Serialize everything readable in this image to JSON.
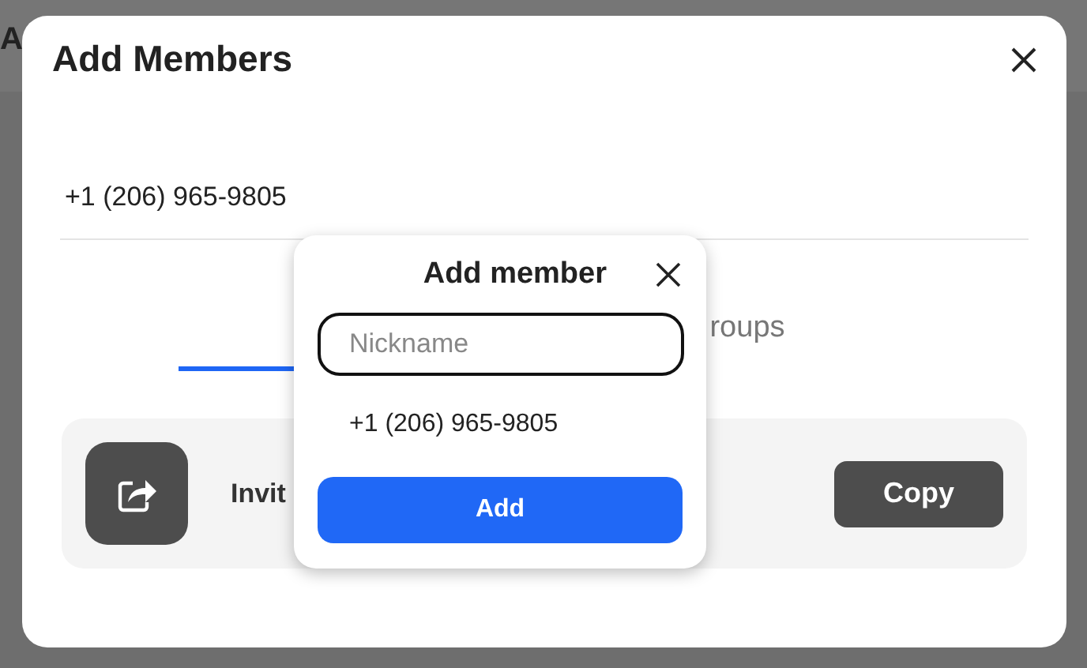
{
  "background_title": "A",
  "dialog": {
    "title": "Add Members",
    "phone": "+1 (206) 965-9805"
  },
  "tabs": [
    {
      "selected": true
    },
    {
      "label": "roups",
      "selected": false
    }
  ],
  "invite": {
    "label": "Invit",
    "button": "Copy"
  },
  "popup": {
    "title": "Add member",
    "nickname": {
      "placeholder": "Nickname"
    },
    "phone": "+1 (206) 965-9805",
    "button": "Add"
  }
}
